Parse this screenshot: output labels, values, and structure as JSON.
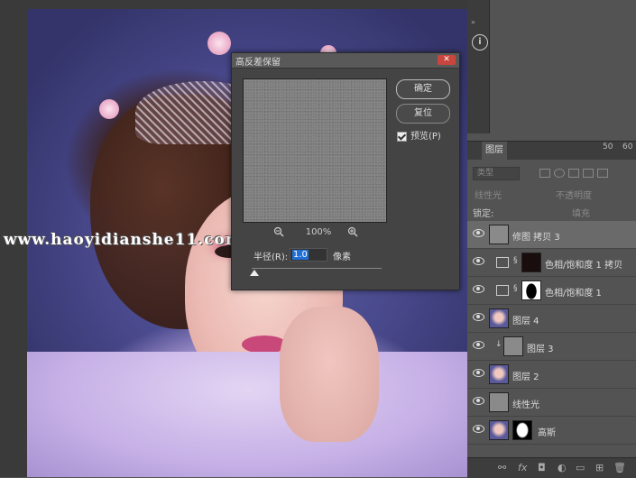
{
  "watermark": "www.haoyidianshe11.com",
  "dialog": {
    "title": "高反差保留",
    "close_label": "✕",
    "ok_label": "确定",
    "reset_label": "复位",
    "preview_label": "预览(P)",
    "preview_checked": true,
    "zoom_out_icon": "zoom-out-icon",
    "zoom_in_icon": "zoom-in-icon",
    "zoom": "100%",
    "radius_label": "半径(R):",
    "radius_value": "1.0",
    "radius_unit": "像素"
  },
  "toolstrip": {
    "info_icon": "info-icon",
    "info_glyph": "i",
    "collapse_glyph": "»"
  },
  "layers_panel": {
    "tab_label": "图层",
    "filter_kind": "类型",
    "blend_mode": "线性光",
    "opacity_label": "不透明度",
    "lock_label": "锁定:",
    "fill_label": "填充",
    "ruler_ticks": [
      "50",
      "60"
    ],
    "layers": [
      {
        "name": "修图 拷贝 3",
        "selected": true,
        "visible": true
      },
      {
        "name": "色相/饱和度 1 拷贝",
        "selected": false,
        "visible": true,
        "adjustment": true
      },
      {
        "name": "色相/饱和度 1",
        "selected": false,
        "visible": true,
        "adjustment": true
      },
      {
        "name": "图层 4",
        "selected": false,
        "visible": true
      },
      {
        "name": "图层 3",
        "selected": false,
        "visible": true,
        "clipped": true
      },
      {
        "name": "图层 2",
        "selected": false,
        "visible": true
      },
      {
        "name": "线性光",
        "selected": false,
        "visible": true
      },
      {
        "name": "高斯",
        "selected": false,
        "visible": true
      }
    ],
    "bottom_icons": [
      "link-icon",
      "fx-icon",
      "mask-icon",
      "adjustment-icon",
      "group-icon",
      "new-layer-icon",
      "trash-icon"
    ],
    "bottom_glyphs": [
      "⚯",
      "fx",
      "◘",
      "◐",
      "▭",
      "⊞",
      "🗑"
    ]
  }
}
